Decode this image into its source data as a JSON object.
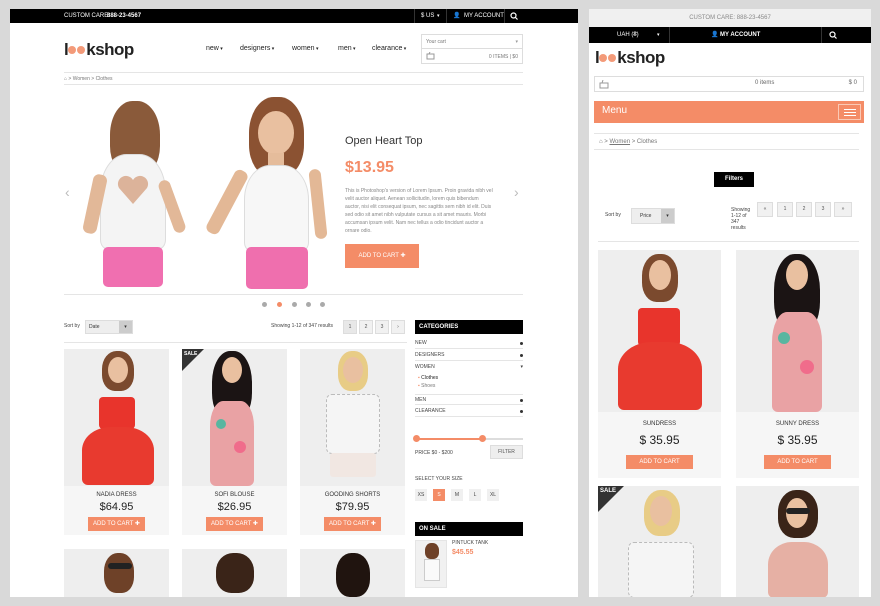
{
  "desktop": {
    "topbar": {
      "custom_care": "CUSTOM CARE:",
      "phone": "888-23-4567",
      "currency": "$ US",
      "account": "MY ACCOUNT"
    },
    "logo": {
      "pre": "l",
      "post": "kshop"
    },
    "nav": [
      "new",
      "designers",
      "women",
      "men",
      "clearance"
    ],
    "cart": {
      "label": "Your cart",
      "summary": "0 ITEMS | $0"
    },
    "breadcrumb": [
      "Women",
      "Clothes"
    ],
    "hero": {
      "title": "Open Heart Top",
      "price": "$13.95",
      "description": "This is Photoshop's version  of Lorem Ipsum. Proin gravida nibh vel velit auctor aliquet. Aenean sollicitudin, lorem quis bibendum auctor, nisi elit consequat ipsum, nec sagittis sem nibh id elit. Duis sed odio sit amet nibh vulputate cursus a sit amet mauris. Morbi accumsan ipsum velit. Nam nec tellus a odio tincidunt auctor a ornare odio.",
      "button": "ADD TO CART"
    },
    "sort": {
      "label": "Sort by",
      "value": "Date"
    },
    "showing": "Showing 1-12 of 347 results",
    "pages": [
      "1",
      "2",
      "3"
    ],
    "products": [
      {
        "name": "NADIA DRESS",
        "price": "$64.95",
        "button": "ADD TO CART"
      },
      {
        "name": "SOFI BLOUSE",
        "price": "$26.95",
        "button": "ADD TO CART",
        "sale": "SALE"
      },
      {
        "name": "GOODING SHORTS",
        "price": "$79.95",
        "button": "ADD TO CART"
      }
    ],
    "categories": {
      "title": "CATEGORIES",
      "items": [
        "NEW",
        "DESIGNERS",
        "WOMEN",
        "MEN",
        "CLEARANCE"
      ],
      "sub": [
        "Clothes",
        "Shoes"
      ]
    },
    "filter": {
      "price": "PRICE $0 - $200",
      "button": "FILTER"
    },
    "sizes": {
      "title": "SELECT YOUR SIZE",
      "options": [
        "XS",
        "S",
        "M",
        "L",
        "XL"
      ],
      "selected": "S"
    },
    "on_sale": {
      "title": "ON SALE",
      "name": "PINTUCK TANK",
      "price": "$45.55"
    }
  },
  "mobile": {
    "custom_care": "CUSTOM CARE: 888-23-4567",
    "currency": "UAH (₴)",
    "account": "MY ACCOUNT",
    "logo": {
      "pre": "l",
      "post": "kshop"
    },
    "cart": {
      "items": "0 items",
      "total": "$ 0"
    },
    "menu": "Menu",
    "breadcrumb": [
      "Women",
      "Clothes"
    ],
    "filters": "Filters",
    "sort": {
      "label": "Sort by",
      "value": "Price"
    },
    "showing": [
      "Showing",
      "1-12 of",
      "347",
      "results"
    ],
    "pages": [
      "«",
      "1",
      "2",
      "3",
      "»"
    ],
    "products": [
      {
        "name": "SUNDRESS",
        "price": "$ 35.95",
        "button": "ADD TO CART"
      },
      {
        "name": "SUNNY DRESS",
        "price": "$ 35.95",
        "button": "ADD TO CART"
      }
    ],
    "sale": "SALE"
  },
  "colors": {
    "accent": "#f48c67",
    "black": "#000000"
  }
}
